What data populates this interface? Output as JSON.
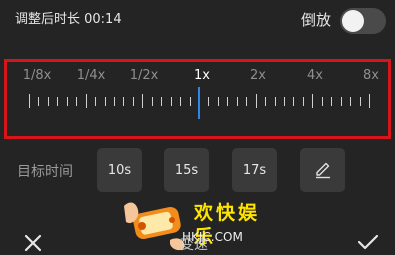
{
  "header": {
    "duration_label": "调整后时长 00:14",
    "reverse_label": "倒放",
    "reverse_on": false
  },
  "speed": {
    "options": [
      "1/8x",
      "1/4x",
      "1/2x",
      "1x",
      "2x",
      "4x",
      "8x"
    ],
    "selected": "1x",
    "accent_color": "#2d87e6",
    "highlight_border_color": "#d8141b"
  },
  "target_time": {
    "label": "目标时间",
    "options": [
      "10s",
      "15s",
      "17s"
    ],
    "edit_icon": "pencil-icon"
  },
  "watermark": {
    "text": "欢快娱乐",
    "url": "HKJC.COM"
  },
  "bottom_bar": {
    "title": "变速",
    "close_icon": "close-icon",
    "confirm_icon": "check-icon"
  }
}
